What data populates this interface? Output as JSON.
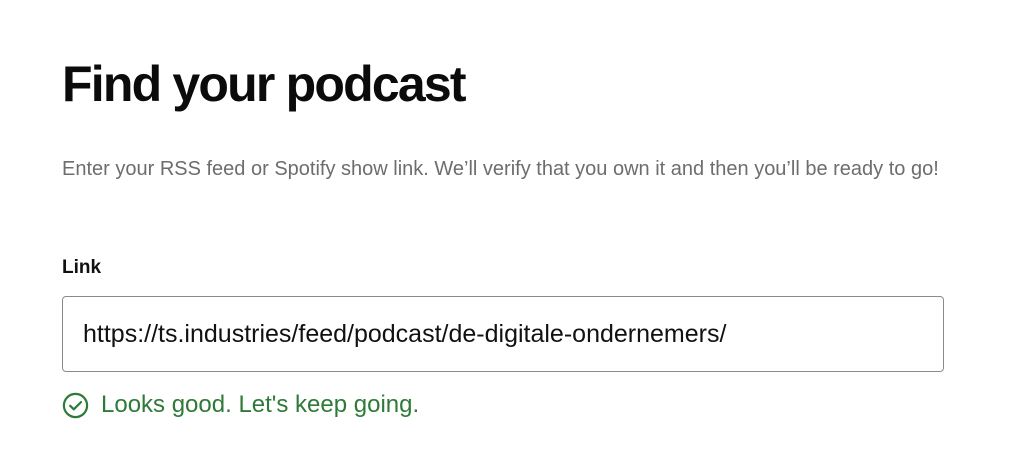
{
  "page": {
    "title": "Find your podcast",
    "subtitle": "Enter your RSS feed or Spotify show link. We’ll verify that you own it and then you’ll be ready to go!"
  },
  "form": {
    "link_label": "Link",
    "link_value": "https://ts.industries/feed/podcast/de-digitale-ondernemers/"
  },
  "validation": {
    "icon": "check-circle-icon",
    "message": "Looks good. Let's keep going.",
    "color": "#2f7a38"
  }
}
